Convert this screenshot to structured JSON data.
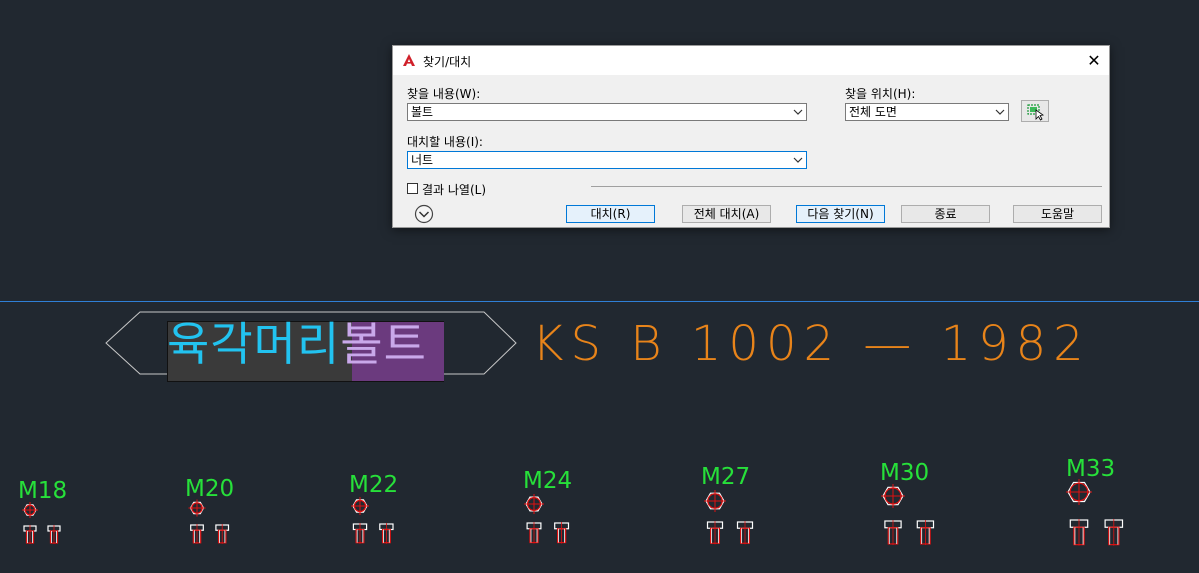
{
  "drawing": {
    "title_part1": "육각머리",
    "title_part2": "볼트",
    "standard": "KS B 1002 — 1982",
    "sizes": [
      "M18",
      "M20",
      "M22",
      "M24",
      "M27",
      "M30",
      "M33"
    ],
    "colors": {
      "background": "#212830",
      "title": "#22c3f0",
      "title_highlight": "#6b3a7e",
      "standard_text": "#e8841a",
      "size_label": "#27e03a",
      "bolt_red": "#e01010",
      "bolt_white": "#ffffff",
      "divider_line": "#2f7fd6"
    }
  },
  "dialog": {
    "title": "찾기/대치",
    "app_icon": "autocad-a-icon",
    "find_label": "찾을 내용(W):",
    "find_value": "볼트",
    "replace_label": "대치할 내용(I):",
    "replace_value": "너트",
    "location_label": "찾을 위치(H):",
    "location_value": "전체 도면",
    "list_results_label": "결과 나열(L)",
    "list_results_checked": false,
    "buttons": {
      "replace": "대치(R)",
      "replace_all": "전체 대치(A)",
      "find_next": "다음 찾기(N)",
      "close": "종료",
      "help": "도움말"
    }
  }
}
